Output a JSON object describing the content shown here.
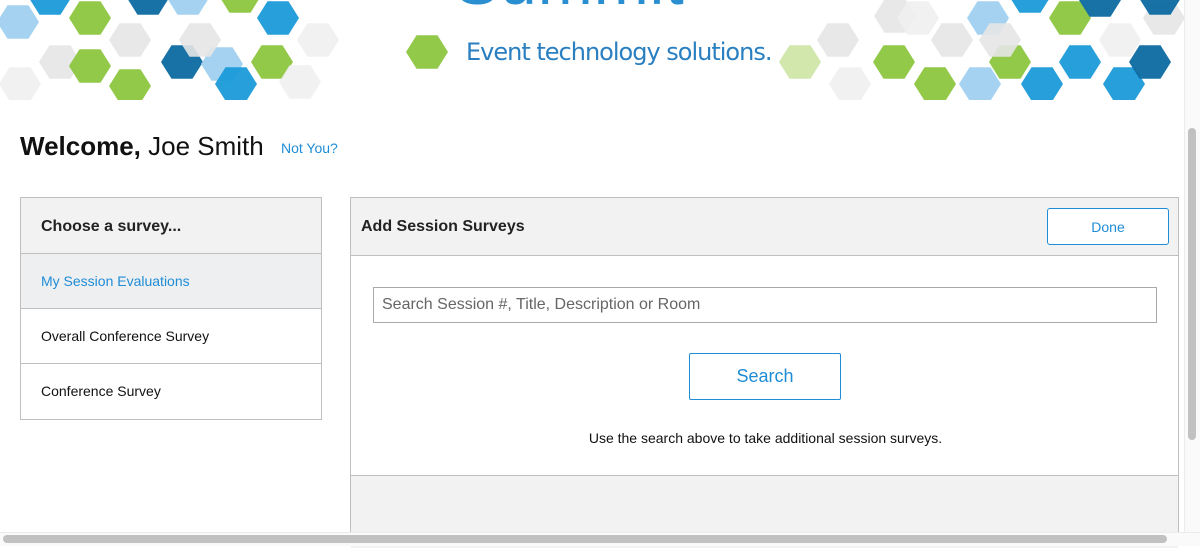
{
  "banner": {
    "brand_word": "Summit",
    "tagline": "Event technology solutions."
  },
  "colors": {
    "accent": "#1f8dd6",
    "panel_header_bg": "#f2f2f2",
    "border": "#bfbfbf",
    "hex_green": "#8dc63f",
    "hex_blue": "#1a9ad9",
    "hex_dark_blue": "#0d6aa0"
  },
  "welcome": {
    "greeting": "Welcome,",
    "user_name": "Joe Smith",
    "not_you": "Not You?"
  },
  "survey_menu": {
    "heading": "Choose a survey...",
    "items": [
      {
        "label": "My Session Evaluations",
        "active": true
      },
      {
        "label": "Overall Conference Survey",
        "active": false
      },
      {
        "label": "Conference Survey",
        "active": false
      }
    ]
  },
  "session_panel": {
    "title": "Add Session Surveys",
    "done_label": "Done",
    "search_placeholder": "Search Session #, Title, Description or Room",
    "search_value": "",
    "search_button_label": "Search",
    "hint": "Use the search above to take additional session surveys."
  }
}
